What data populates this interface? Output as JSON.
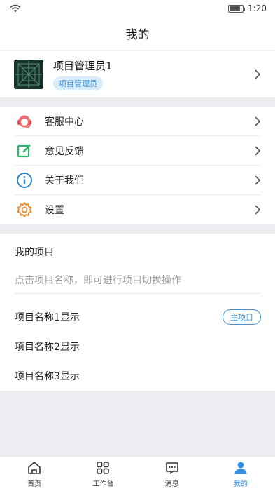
{
  "status_bar": {
    "time": "1:20",
    "battery_level": 0.85
  },
  "header": {
    "title": "我的"
  },
  "profile": {
    "name": "项目管理员1",
    "role": "项目管理员"
  },
  "menu": {
    "items": [
      {
        "label": "客服中心",
        "icon": "headset-icon"
      },
      {
        "label": "意见反馈",
        "icon": "edit-icon"
      },
      {
        "label": "关于我们",
        "icon": "info-icon"
      },
      {
        "label": "设置",
        "icon": "gear-icon"
      }
    ]
  },
  "projects": {
    "title": "我的项目",
    "hint": "点击项目名称，即可进行项目切换操作",
    "items": [
      {
        "name": "项目名称1显示",
        "badge": "主项目"
      },
      {
        "name": "项目名称2显示"
      },
      {
        "name": "项目名称3显示"
      }
    ]
  },
  "tabbar": {
    "tabs": [
      {
        "label": "首页",
        "icon": "home-icon"
      },
      {
        "label": "工作台",
        "icon": "grid-icon"
      },
      {
        "label": "消息",
        "icon": "message-icon"
      },
      {
        "label": "我的",
        "icon": "user-icon",
        "active": true
      }
    ]
  },
  "colors": {
    "accent": "#2d8fe6",
    "badge_bg": "#d9ecfb",
    "background": "#eceef1"
  }
}
